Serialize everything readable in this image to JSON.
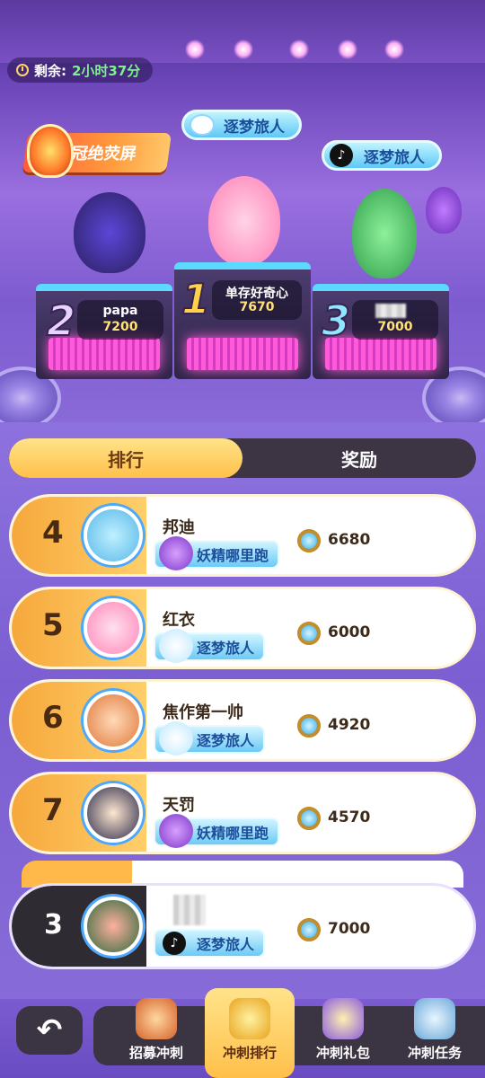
{
  "timer": {
    "label": "剩余:",
    "value": "2小时37分"
  },
  "top_badges": {
    "crown": "冠绝荧屏",
    "center_title": "逐梦旅人",
    "right_title": "逐梦旅人"
  },
  "podium": [
    {
      "rank": "2",
      "name": "papa",
      "score": "7200"
    },
    {
      "rank": "1",
      "name": "单存好奇心",
      "score": "7670"
    },
    {
      "rank": "3",
      "name": "",
      "score": "7000"
    }
  ],
  "tabs": [
    {
      "label": "排行",
      "active": true
    },
    {
      "label": "奖励",
      "active": false
    }
  ],
  "rows": [
    {
      "rank": "4",
      "name": "邦迪",
      "badge": "妖精哪里跑",
      "score": "6680"
    },
    {
      "rank": "5",
      "name": "红衣",
      "badge": "逐梦旅人",
      "score": "6000"
    },
    {
      "rank": "6",
      "name": "焦作第一帅",
      "badge": "逐梦旅人",
      "score": "4920"
    },
    {
      "rank": "7",
      "name": "天罚",
      "badge": "妖精哪里跑",
      "score": "4570"
    }
  ],
  "my_row": {
    "rank": "3",
    "name": "",
    "badge": "逐梦旅人",
    "score": "7000"
  },
  "bottom_nav": [
    {
      "label": "招募冲刺",
      "active": false
    },
    {
      "label": "冲刺排行",
      "active": true
    },
    {
      "label": "冲刺礼包",
      "active": false
    },
    {
      "label": "冲刺任务",
      "active": false
    }
  ],
  "colors": {
    "accent": "#ffc04a",
    "panel": "#7b5fd2",
    "dark": "#3b3442"
  }
}
